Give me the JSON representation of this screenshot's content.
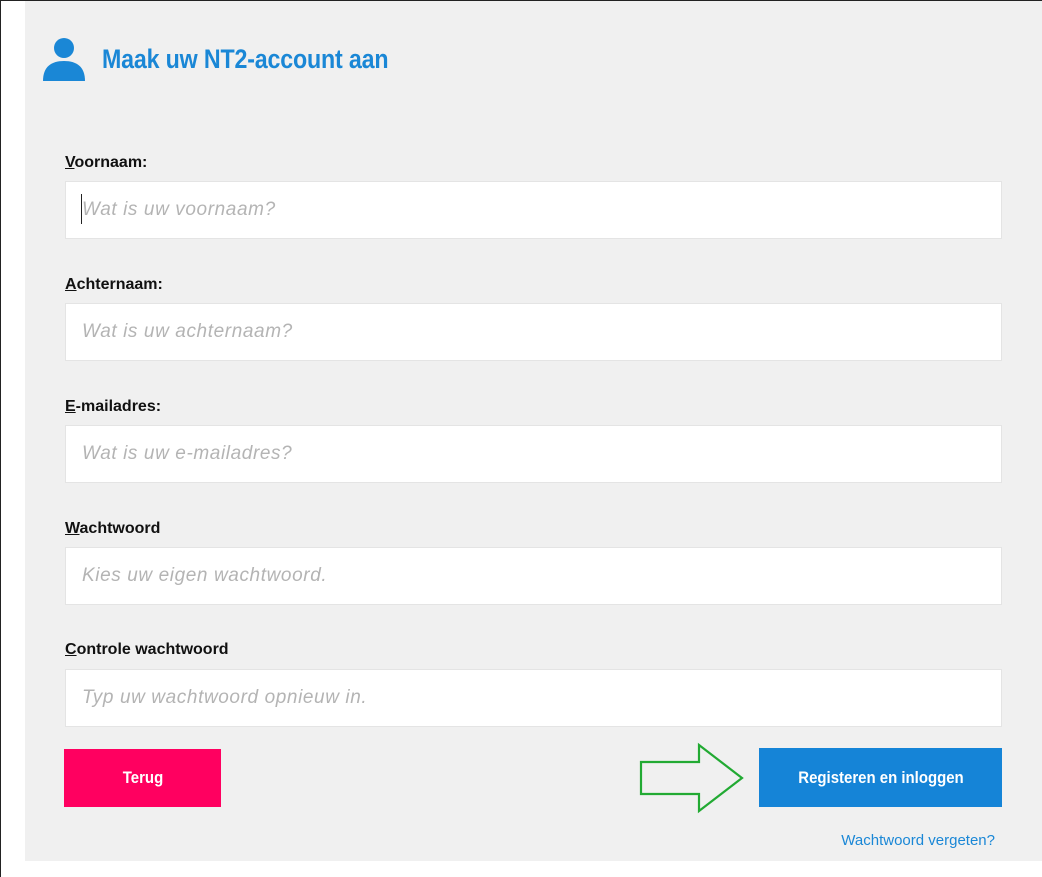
{
  "header": {
    "title": "Maak uw NT2-account aan",
    "icon": "user-icon"
  },
  "fields": [
    {
      "access_key": "V",
      "label_rest": "oornaam:",
      "placeholder": "Wat is uw voornaam?",
      "value": ""
    },
    {
      "access_key": "A",
      "label_rest": "chternaam:",
      "placeholder": "Wat is uw achternaam?",
      "value": ""
    },
    {
      "access_key": "E",
      "label_rest": "-mailadres:",
      "placeholder": "Wat is uw e-mailadres?",
      "value": ""
    },
    {
      "access_key": "W",
      "label_rest": "achtwoord",
      "placeholder": "Kies uw eigen wachtwoord.",
      "value": ""
    },
    {
      "access_key": "C",
      "label_rest": "ontrole wachtwoord",
      "placeholder": "Typ uw wachtwoord opnieuw in.",
      "value": ""
    }
  ],
  "buttons": {
    "back_label": "Terug",
    "register_label": "Registeren en inloggen"
  },
  "links": {
    "forgot_password": "Wachtwoord vergeten?"
  },
  "colors": {
    "accent": "#1a87d6",
    "back_button": "#ff0060",
    "register_button": "#1584d7",
    "arrow_annotation": "#22aa33",
    "panel_background": "#f0f0f0"
  }
}
